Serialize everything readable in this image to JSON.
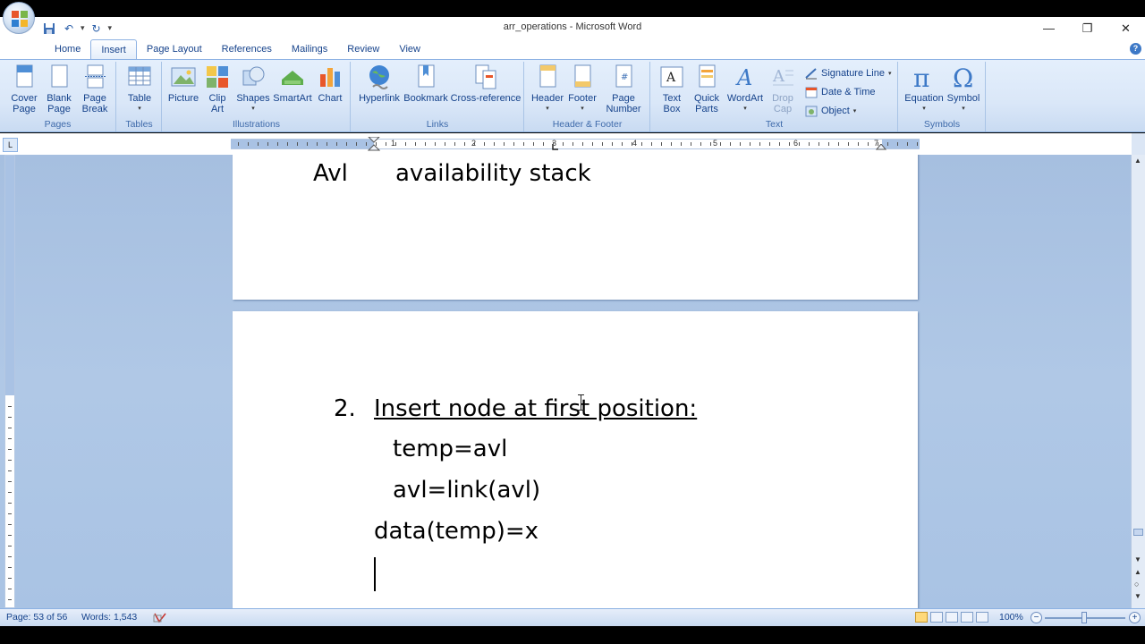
{
  "window": {
    "title": "arr_operations - Microsoft Word"
  },
  "tabs": [
    "Home",
    "Insert",
    "Page Layout",
    "References",
    "Mailings",
    "Review",
    "View"
  ],
  "active_tab": "Insert",
  "ribbon": {
    "pages": {
      "label": "Pages",
      "cover_page": "Cover\nPage",
      "blank_page": "Blank\nPage",
      "page_break": "Page\nBreak"
    },
    "tables": {
      "label": "Tables",
      "table": "Table"
    },
    "illustrations": {
      "label": "Illustrations",
      "picture": "Picture",
      "clip_art": "Clip\nArt",
      "shapes": "Shapes",
      "smartart": "SmartArt",
      "chart": "Chart"
    },
    "links": {
      "label": "Links",
      "hyperlink": "Hyperlink",
      "bookmark": "Bookmark",
      "cross_reference": "Cross-reference"
    },
    "header_footer": {
      "label": "Header & Footer",
      "header": "Header",
      "footer": "Footer",
      "page_number": "Page\nNumber"
    },
    "text": {
      "label": "Text",
      "text_box": "Text\nBox",
      "quick_parts": "Quick\nParts",
      "wordart": "WordArt",
      "drop_cap": "Drop\nCap",
      "signature_line": "Signature Line",
      "date_time": "Date & Time",
      "object": "Object"
    },
    "symbols": {
      "label": "Symbols",
      "equation": "Equation",
      "symbol": "Symbol"
    }
  },
  "ruler": {
    "numbers": [
      "1",
      "1",
      "2",
      "3",
      "4",
      "5",
      "6",
      "7"
    ]
  },
  "document": {
    "page1": {
      "line_left": "Avl",
      "line_right": "availability stack"
    },
    "page2": {
      "list_number": "2.",
      "heading": "Insert node at first position:",
      "line1": "temp=avl",
      "line2": "avl=link(avl)",
      "line3": "data(temp)=x"
    }
  },
  "status": {
    "page": "Page: 53 of 56",
    "words": "Words: 1,543",
    "zoom": "100%"
  }
}
